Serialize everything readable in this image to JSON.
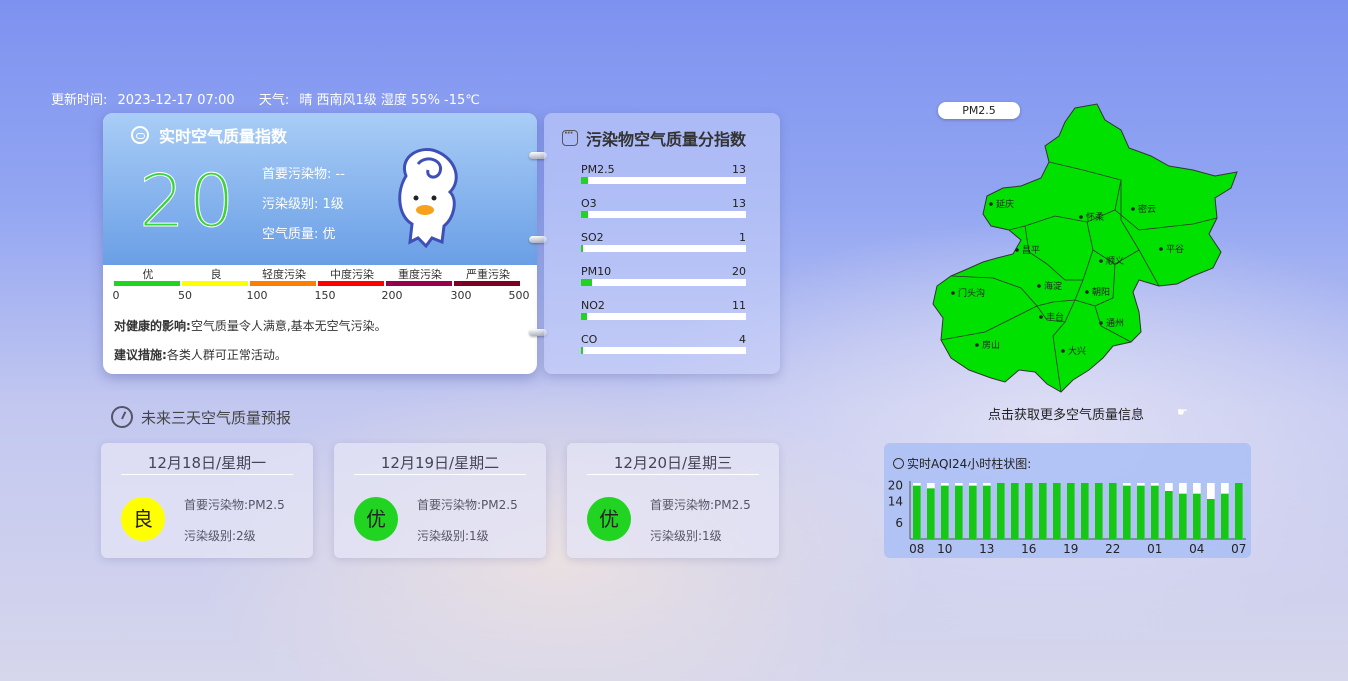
{
  "header": {
    "update_label": "更新时间:",
    "update_time": "2023-12-17 07:00",
    "weather_label": "天气:",
    "weather_text": "晴 西南风1级 湿度 55% -15℃"
  },
  "aqi": {
    "title": "实时空气质量指数",
    "value": "20",
    "primary_label": "首要污染物:",
    "primary_value": "--",
    "level_label": "污染级别:",
    "level_value": "1级",
    "quality_label": "空气质量:",
    "quality_value": "优",
    "scale_labels": [
      "优",
      "良",
      "轻度污染",
      "中度污染",
      "重度污染",
      "严重污染"
    ],
    "scale_colors": [
      "#22d422",
      "#ffff00",
      "#ff7e00",
      "#ff0000",
      "#99004c",
      "#7e0023"
    ],
    "scale_ticks": [
      "0",
      "50",
      "100",
      "150",
      "200",
      "300",
      "500"
    ],
    "health_label": "对健康的影响:",
    "health_text": "空气质量令人满意,基本无空气污染。",
    "advice_label": "建议措施:",
    "advice_text": "各类人群可正常活动。"
  },
  "pollutants": {
    "title": "污染物空气质量分指数",
    "items": [
      {
        "name": "PM2.5",
        "value": "13",
        "fraction": 0.04
      },
      {
        "name": "O3",
        "value": "13",
        "fraction": 0.04
      },
      {
        "name": "SO2",
        "value": "1",
        "fraction": 0.005
      },
      {
        "name": "PM10",
        "value": "20",
        "fraction": 0.065
      },
      {
        "name": "NO2",
        "value": "11",
        "fraction": 0.035
      },
      {
        "name": "CO",
        "value": "4",
        "fraction": 0.012
      }
    ]
  },
  "forecast": {
    "title": "未来三天空气质量预报",
    "days": [
      {
        "date": "12月18日/星期一",
        "badge": "良",
        "color": "#ffff00",
        "primary": "首要污染物:PM2.5",
        "level": "污染级别:2级"
      },
      {
        "date": "12月19日/星期二",
        "badge": "优",
        "color": "#22d422",
        "primary": "首要污染物:PM2.5",
        "level": "污染级别:1级"
      },
      {
        "date": "12月20日/星期三",
        "badge": "优",
        "color": "#22d422",
        "primary": "首要污染物:PM2.5",
        "level": "污染级别:1级"
      }
    ]
  },
  "map": {
    "tag": "PM2.5",
    "fill_color": "#00e100",
    "districts": [
      "延庆",
      "怀柔",
      "密云",
      "昌平",
      "顺义",
      "平谷",
      "门头沟",
      "海淀",
      "朝阳",
      "丰台",
      "通州",
      "房山",
      "大兴"
    ],
    "link_text": "点击获取更多空气质量信息"
  },
  "hourly": {
    "title": "实时AQI24小时柱状图:",
    "chart_data": {
      "type": "bar",
      "categories": [
        "08",
        "09",
        "10",
        "11",
        "12",
        "13",
        "14",
        "15",
        "16",
        "17",
        "18",
        "19",
        "20",
        "21",
        "22",
        "23",
        "00",
        "01",
        "02",
        "03",
        "04",
        "05",
        "06",
        "07"
      ],
      "values": [
        20,
        19,
        20,
        20,
        20,
        20,
        21,
        21,
        21,
        21,
        21,
        21,
        21,
        21,
        21,
        20,
        20,
        20,
        18,
        17,
        17,
        15,
        17,
        21
      ],
      "y_ticks": [
        "6",
        "14",
        "20"
      ],
      "x_ticks": [
        "08",
        "10",
        "13",
        "16",
        "19",
        "22",
        "01",
        "04",
        "07"
      ],
      "ylim": [
        0,
        21
      ]
    }
  }
}
